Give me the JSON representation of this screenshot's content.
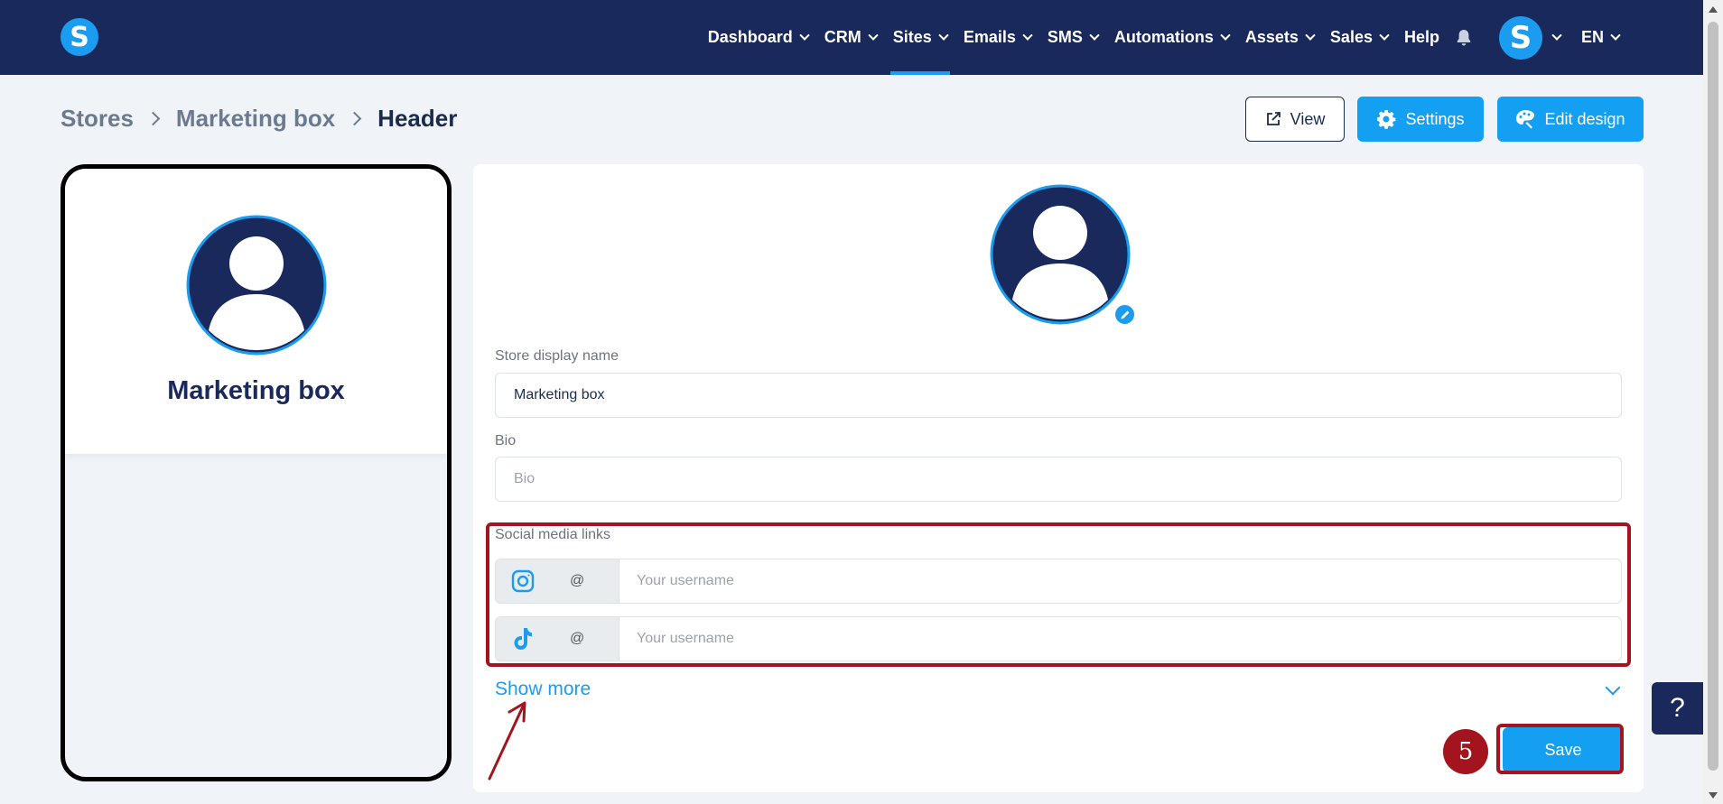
{
  "nav": {
    "logo_letter": "S",
    "items": [
      {
        "label": "Dashboard",
        "dropdown": true
      },
      {
        "label": "CRM",
        "dropdown": true
      },
      {
        "label": "Sites",
        "dropdown": true,
        "active": true
      },
      {
        "label": "Emails",
        "dropdown": true
      },
      {
        "label": "SMS",
        "dropdown": true
      },
      {
        "label": "Automations",
        "dropdown": true
      },
      {
        "label": "Assets",
        "dropdown": true
      },
      {
        "label": "Sales",
        "dropdown": true
      },
      {
        "label": "Help",
        "dropdown": false
      }
    ],
    "user_initial": "S",
    "language": "EN"
  },
  "breadcrumb": {
    "items": [
      "Stores",
      "Marketing box",
      "Header"
    ]
  },
  "actions": {
    "view_label": "View",
    "settings_label": "Settings",
    "edit_design_label": "Edit design"
  },
  "preview": {
    "store_name": "Marketing box"
  },
  "form": {
    "display_name_label": "Store display name",
    "display_name_value": "Marketing box",
    "bio_label": "Bio",
    "bio_placeholder": "Bio",
    "social_label": "Social media links",
    "social_links": [
      {
        "platform": "instagram-icon",
        "prefix": "@",
        "placeholder": "Your username"
      },
      {
        "platform": "tiktok-icon",
        "prefix": "@",
        "placeholder": "Your username"
      }
    ],
    "show_more_label": "Show more",
    "save_label": "Save"
  },
  "annotation": {
    "step_number": "5",
    "color": "#a3141e"
  },
  "help_label": "?",
  "colors": {
    "nav_bg": "#19295b",
    "accent": "#1a9cf0",
    "button": "#13a0f2",
    "page_bg": "#f0f4f9"
  }
}
